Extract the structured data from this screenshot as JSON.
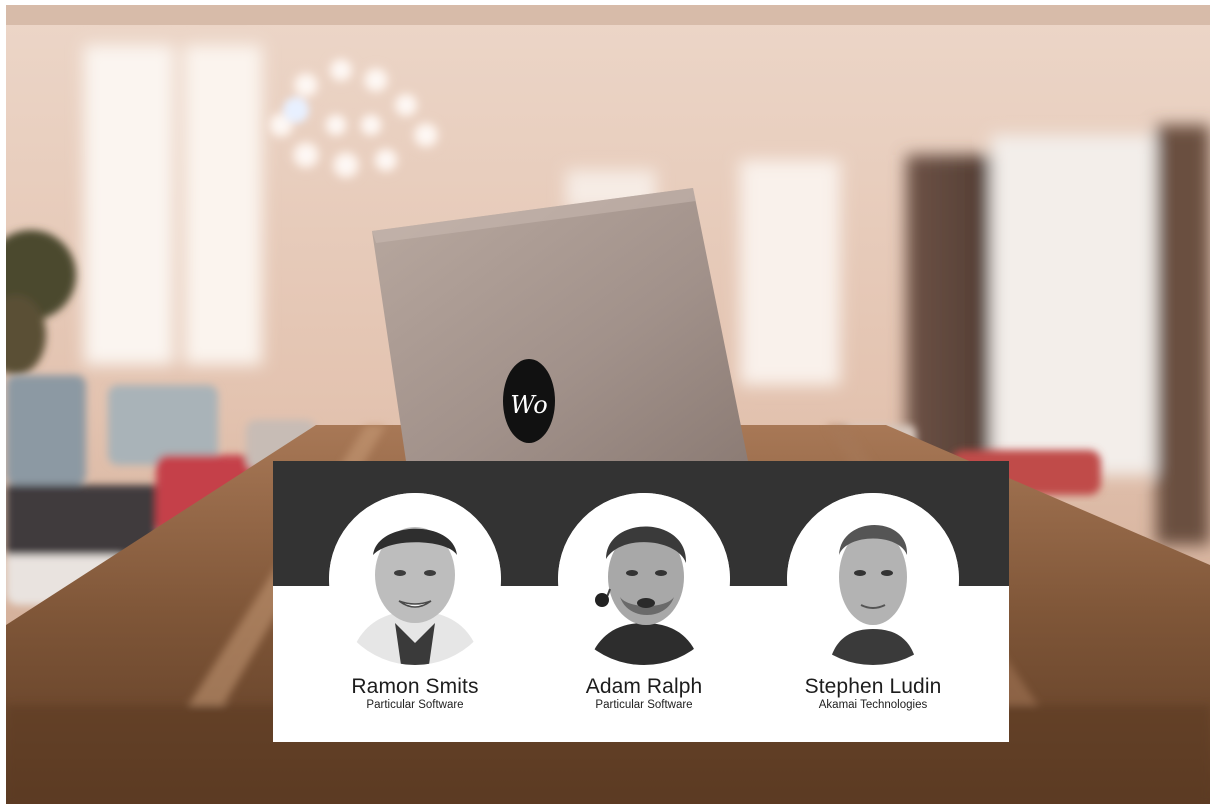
{
  "photo": {
    "laptop_sticker_text": "Wo"
  },
  "speakers": [
    {
      "name": "Ramon Smits",
      "company": "Particular Software",
      "portrait_icon": "man-portrait-smiling"
    },
    {
      "name": "Adam Ralph",
      "company": "Particular Software",
      "portrait_icon": "man-portrait-headset-mic"
    },
    {
      "name": "Stephen Ludin",
      "company": "Akamai Technologies",
      "portrait_icon": "man-portrait"
    }
  ],
  "colors": {
    "card_band": "#333333",
    "card_body": "#ffffff",
    "text": "#1d1d1d"
  }
}
